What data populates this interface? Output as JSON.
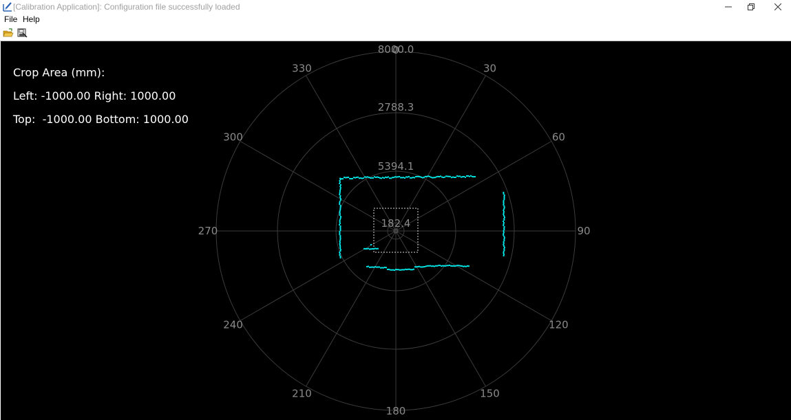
{
  "window": {
    "title": "[Calibration Application]: Configuration file successfully loaded",
    "app_icon": "pencil-chart-icon",
    "controls": [
      "minimize-icon",
      "restore-icon",
      "close-icon"
    ]
  },
  "menu": {
    "file_label": "File",
    "help_label": "Help"
  },
  "toolbar": {
    "open_icon": "open-folder-icon",
    "save_icon": "save-icon"
  },
  "crop": {
    "heading": "Crop Area (mm):",
    "left_right": "Left: -1000.00 Right: 1000.00",
    "top_bottom": "Top:  -1000.00 Bottom: 1000.00"
  },
  "polar": {
    "ring_labels": [
      "182.4",
      "2788.3",
      "5394.1",
      "8000.0"
    ],
    "angle_labels": [
      "0",
      "30",
      "60",
      "90",
      "120",
      "150",
      "180",
      "210",
      "240",
      "270",
      "300",
      "330"
    ],
    "grid_color": "#3c3c3c",
    "label_color": "#8a8a8a",
    "scan_color": "#00e5e5",
    "crop_box_color": "#dcdcdc"
  }
}
